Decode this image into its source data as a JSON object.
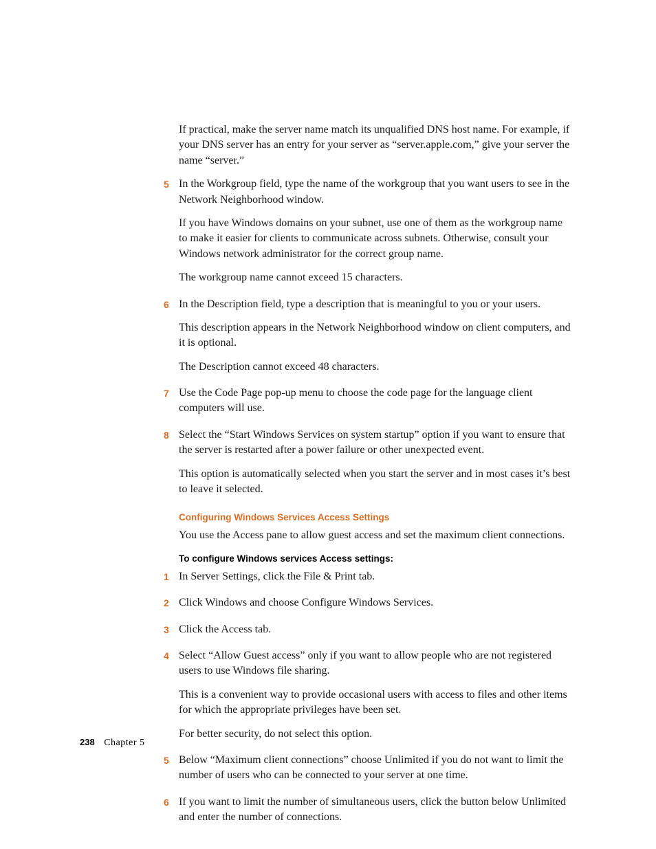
{
  "intro": "If practical, make the server name match its unqualified DNS host name. For example, if your DNS server has an entry for your server as “server.apple.com,” give your server the name “server.”",
  "stepsA": [
    {
      "num": "5",
      "paras": [
        "In the Workgroup field, type the name of the workgroup that you want users to see in the Network Neighborhood window.",
        "If you have Windows domains on your subnet, use one of them as the workgroup name to make it easier for clients to communicate across subnets. Otherwise, consult your Windows network administrator for the correct group name.",
        "The workgroup name cannot exceed 15 characters."
      ]
    },
    {
      "num": "6",
      "paras": [
        "In the Description field, type a description that is meaningful to you or your users.",
        "This description appears in the Network Neighborhood window on client computers, and it is optional.",
        "The Description cannot exceed 48 characters."
      ]
    },
    {
      "num": "7",
      "paras": [
        "Use the Code Page pop-up menu to choose the code page for the language client computers will use."
      ]
    },
    {
      "num": "8",
      "paras": [
        "Select the “Start Windows Services on system startup” option if you want to ensure that the server is restarted after a power failure or other unexpected event.",
        "This option is automatically selected when you start the server and in most cases it’s best to leave it selected."
      ]
    }
  ],
  "sectionHeading": "Configuring Windows Services Access Settings",
  "sectionIntro": "You use the Access pane to allow guest access and set the maximum client connections.",
  "subheading": "To configure Windows services Access settings:",
  "stepsB": [
    {
      "num": "1",
      "paras": [
        "In Server Settings, click the File & Print tab."
      ]
    },
    {
      "num": "2",
      "paras": [
        "Click Windows and choose Configure Windows Services."
      ]
    },
    {
      "num": "3",
      "paras": [
        "Click the Access tab."
      ]
    },
    {
      "num": "4",
      "paras": [
        "Select “Allow Guest access” only if you want to allow people who are not registered users to use Windows file sharing.",
        "This is a convenient way to provide occasional users with access to files and other items for which the appropriate privileges have been set.",
        "For better security, do not select this option."
      ]
    },
    {
      "num": "5",
      "paras": [
        "Below “Maximum client connections” choose Unlimited if you do not want to limit the number of users who can be connected to your server at one time."
      ]
    },
    {
      "num": "6",
      "paras": [
        "If you want to limit the number of simultaneous users, click the button below Unlimited and enter the number of connections."
      ]
    }
  ],
  "footer": {
    "page": "238",
    "chapter": "Chapter  5"
  }
}
